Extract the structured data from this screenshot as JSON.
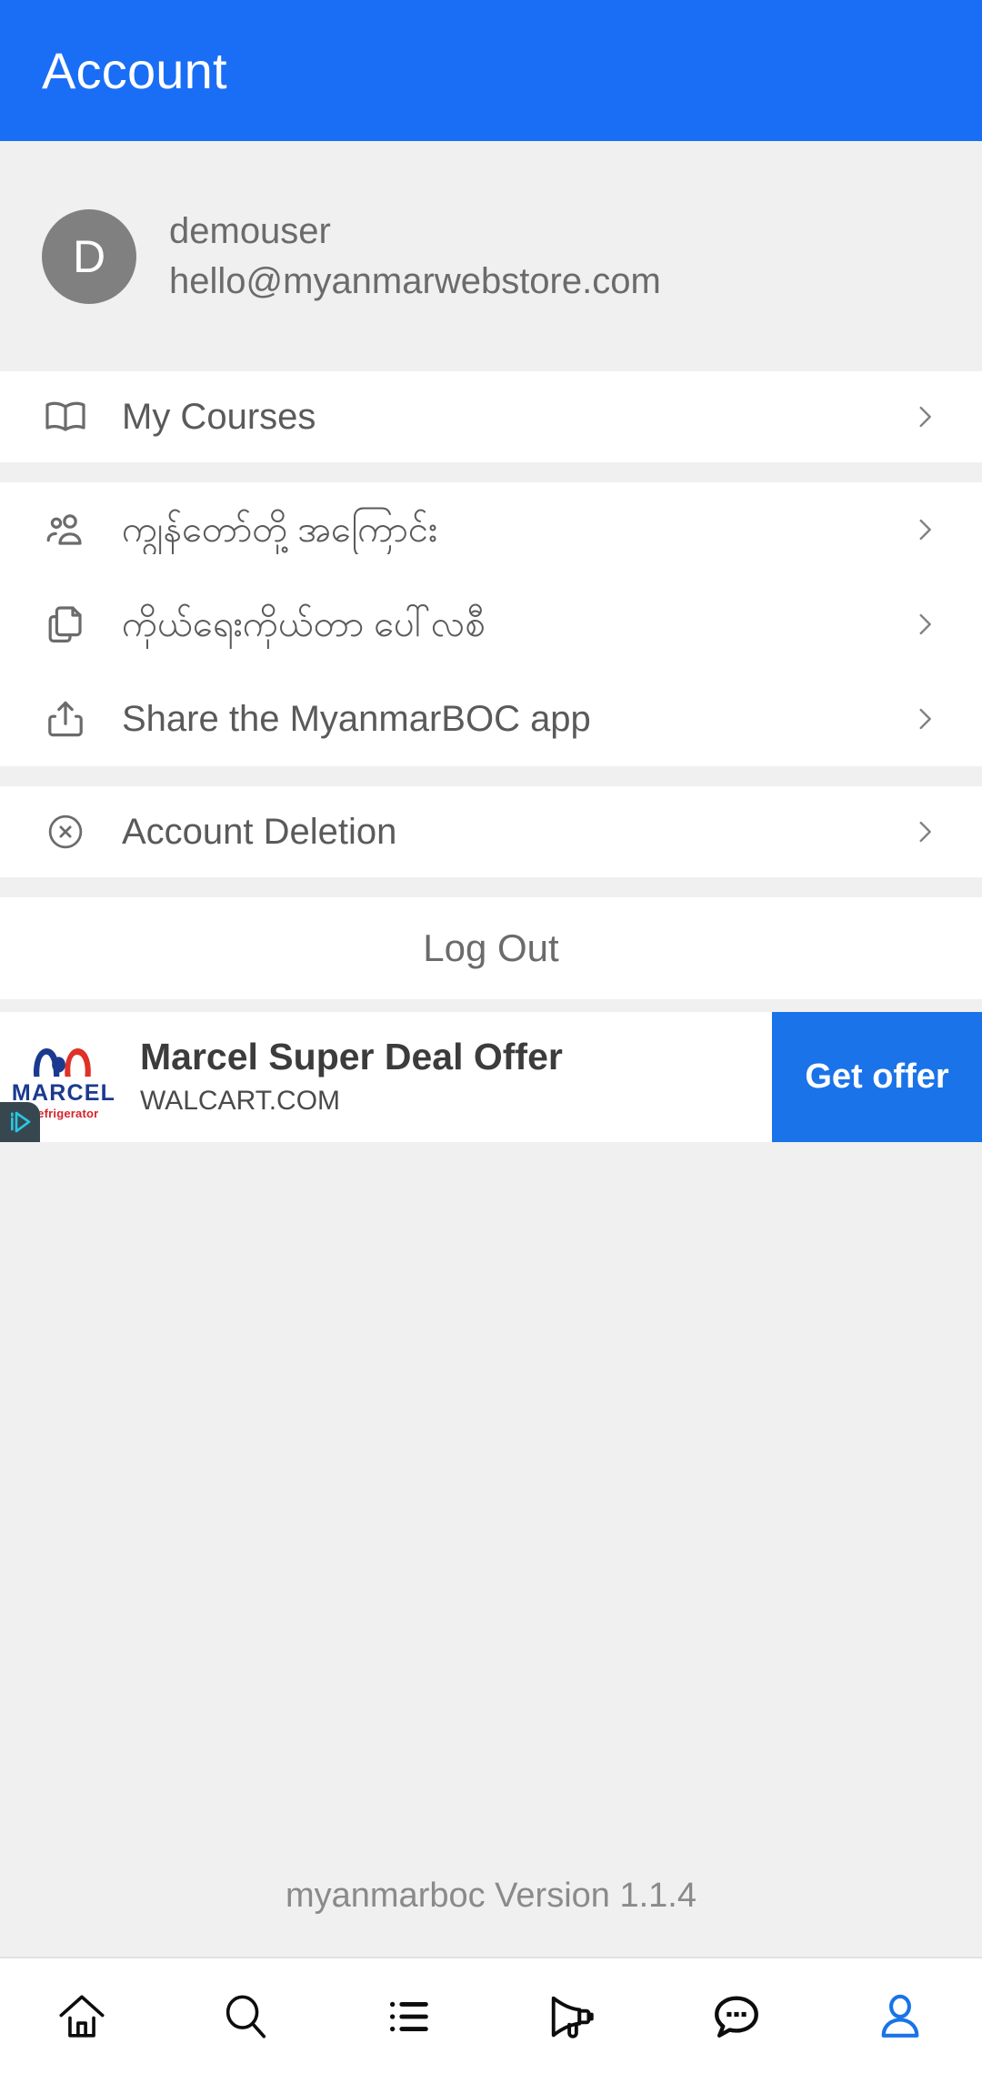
{
  "header": {
    "title": "Account",
    "background_color": "#1a6ef5"
  },
  "profile": {
    "avatar_initial": "D",
    "avatar_color": "#808080",
    "username": "demouser",
    "email": "hello@myanmarwebstore.com"
  },
  "sections": [
    {
      "rows": [
        {
          "icon": "book-open-icon",
          "label": "My Courses",
          "chevron": true
        }
      ]
    },
    {
      "rows": [
        {
          "icon": "people-icon",
          "label": "ကျွန်တော်တို့ အကြောင်း",
          "chevron": true
        },
        {
          "icon": "documents-icon",
          "label": "ကိုယ်ရေးကိုယ်တာ ပေါ်လစီ",
          "chevron": true
        },
        {
          "icon": "share-icon",
          "label": "Share the MyanmarBOC app",
          "chevron": true
        }
      ]
    },
    {
      "rows": [
        {
          "icon": "circle-x-icon",
          "label": "Account Deletion",
          "chevron": true
        }
      ]
    }
  ],
  "logout": {
    "label": "Log Out"
  },
  "ad": {
    "brand_word": "MARCEL",
    "brand_sub": "Refrigerator",
    "title": "Marcel Super Deal Offer",
    "url": "WALCART.COM",
    "cta_label": "Get offer",
    "cta_color": "#1a73e8",
    "adchoices_icon": "adchoices-icon",
    "brand_color": "#1b3a8f",
    "brand_sub_color": "#d8232a"
  },
  "footer": {
    "version_text": "myanmarboc Version 1.1.4"
  },
  "bottom_nav": {
    "active_color": "#1a73e8",
    "items": [
      {
        "icon": "home-icon",
        "label": "Home",
        "active": false
      },
      {
        "icon": "search-icon",
        "label": "Search",
        "active": false
      },
      {
        "icon": "list-icon",
        "label": "List",
        "active": false
      },
      {
        "icon": "megaphone-icon",
        "label": "Announcements",
        "active": false
      },
      {
        "icon": "chat-bubble-icon",
        "label": "Chat",
        "active": false
      },
      {
        "icon": "person-icon",
        "label": "Account",
        "active": true
      }
    ]
  }
}
